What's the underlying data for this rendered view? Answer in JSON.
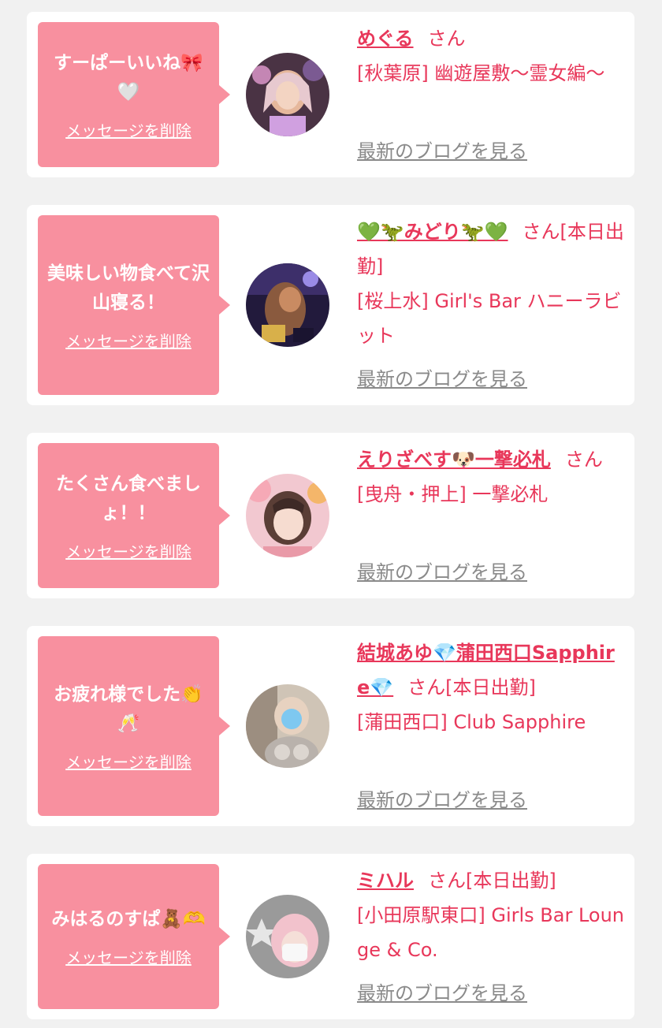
{
  "theme": {
    "background": "#f1f1f1",
    "card": "#ffffff",
    "bubble": "#f8909f",
    "accent": "#e8375a",
    "muted": "#8a8a8a"
  },
  "entries": [
    {
      "message": "すーぱーいいね🎀🤍",
      "delete_label": "メッセージを削除",
      "name": "めぐる",
      "suffix": "さん",
      "shop": "[秋葉原] 幽遊屋敷〜霊女編〜",
      "blog_label": "最新のブログを見る"
    },
    {
      "message": "美味しい物食べて沢山寝る！",
      "delete_label": "メッセージを削除",
      "name": "💚🦖みどり🦖💚",
      "suffix": "さん[本日出勤]",
      "shop": "[桜上水] Girl's Bar ハニーラビット",
      "blog_label": "最新のブログを見る"
    },
    {
      "message": "たくさん食べましょ！！",
      "delete_label": "メッセージを削除",
      "name": "えりざべす🐶一撃必札",
      "suffix": "さん",
      "shop": "[曳舟・押上] 一撃必札",
      "blog_label": "最新のブログを見る"
    },
    {
      "message": "お疲れ様でした👏🥂",
      "delete_label": "メッセージを削除",
      "name": "結城あゆ💎蒲田西口Sapphire💎",
      "suffix": "さん[本日出勤]",
      "shop": "[蒲田西口] Club Sapphire",
      "blog_label": "最新のブログを見る"
    },
    {
      "message": "みはるのすぱ🧸🫶",
      "delete_label": "メッセージを削除",
      "name": "ミハル",
      "suffix": "さん[本日出勤]",
      "shop": "[小田原駅東口] Girls Bar Lounge & Co.",
      "blog_label": "最新のブログを見る"
    }
  ]
}
